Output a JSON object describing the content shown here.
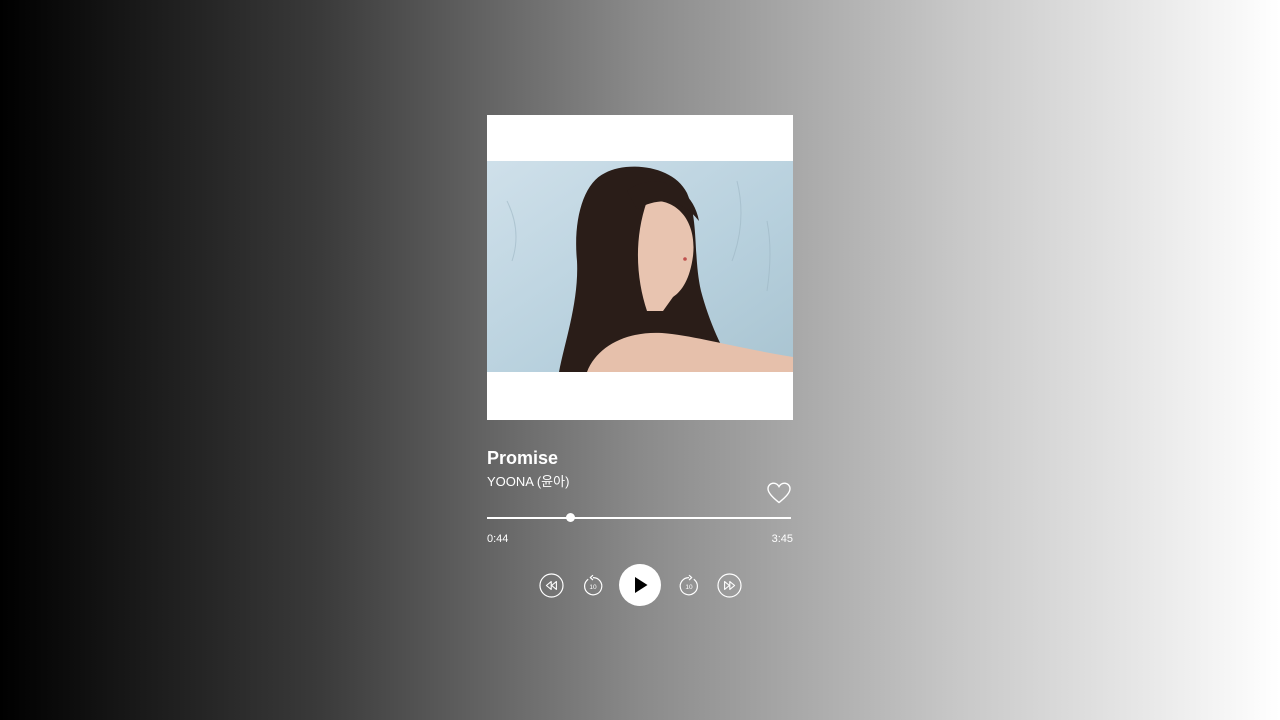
{
  "track": {
    "title": "Promise",
    "artist": "YOONA (윤아)"
  },
  "progress": {
    "current_time": "0:44",
    "total_time": "3:45",
    "fraction": 0.272
  },
  "controls": {
    "rewind_icon": "rewind-icon",
    "skip_back_icon": "replay-10-icon",
    "skip_back_seconds": "10",
    "play_icon": "play-icon",
    "skip_forward_icon": "forward-10-icon",
    "skip_forward_seconds": "10",
    "fast_forward_icon": "fast-forward-icon",
    "like_icon": "heart-outline-icon"
  },
  "colors": {
    "foreground": "#ffffff"
  }
}
